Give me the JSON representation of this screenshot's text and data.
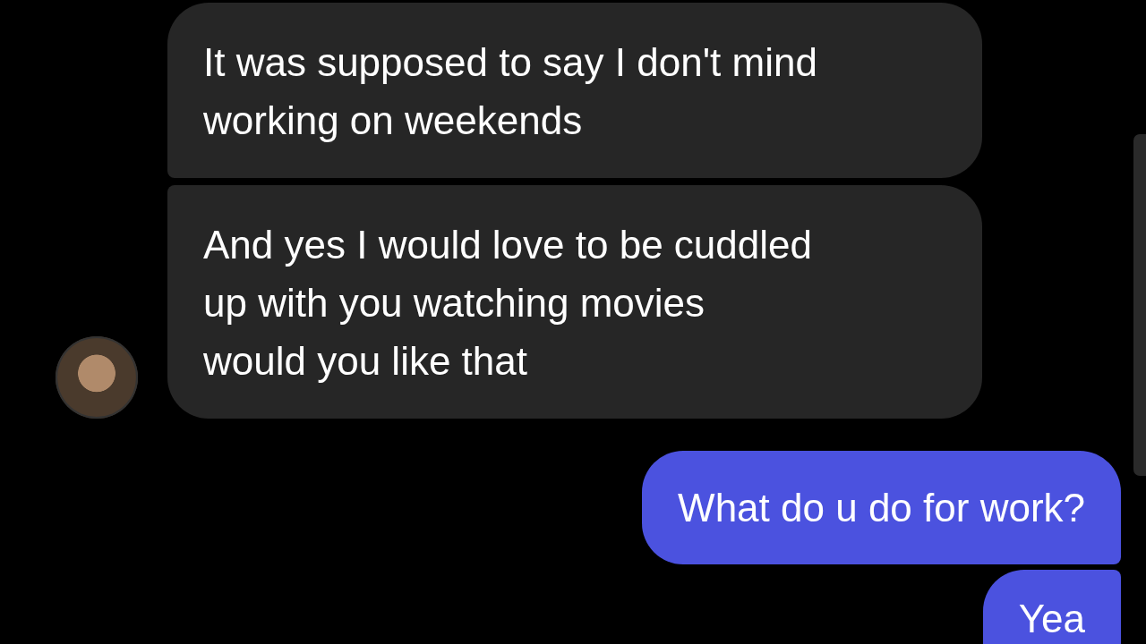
{
  "messages": [
    {
      "kind": "received",
      "lines": [
        "It was supposed to say I don't mind",
        "working on weekends"
      ],
      "avatar": false
    },
    {
      "kind": "received",
      "lines": [
        "And yes I would love to be cuddled",
        "up with you watching movies",
        "would you like that"
      ],
      "avatar": true
    },
    {
      "kind": "sent",
      "lines": [
        "What do u do for work?"
      ]
    },
    {
      "kind": "sent",
      "lines": [
        "Yea"
      ]
    }
  ]
}
